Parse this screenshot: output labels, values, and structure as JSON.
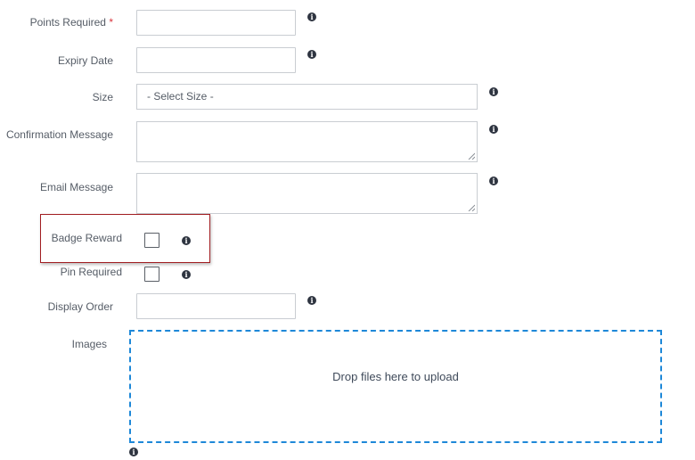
{
  "form": {
    "points_required": {
      "label": "Points Required",
      "required_mark": "*",
      "value": ""
    },
    "expiry_date": {
      "label": "Expiry Date",
      "value": ""
    },
    "size": {
      "label": "Size",
      "selected": "- Select Size -"
    },
    "confirmation_message": {
      "label": "Confirmation Message",
      "value": ""
    },
    "email_message": {
      "label": "Email Message",
      "value": ""
    },
    "badge_reward": {
      "label": "Badge Reward",
      "checked": false
    },
    "pin_required": {
      "label": "Pin Required",
      "checked": false
    },
    "display_order": {
      "label": "Display Order",
      "value": ""
    },
    "images": {
      "label": "Images",
      "dropzone_text": "Drop files here to upload"
    }
  },
  "colors": {
    "highlight_border": "#a11d21",
    "dropzone_border": "#1e88d8",
    "required_mark": "#d9363e",
    "info_icon": "#2e3440"
  }
}
